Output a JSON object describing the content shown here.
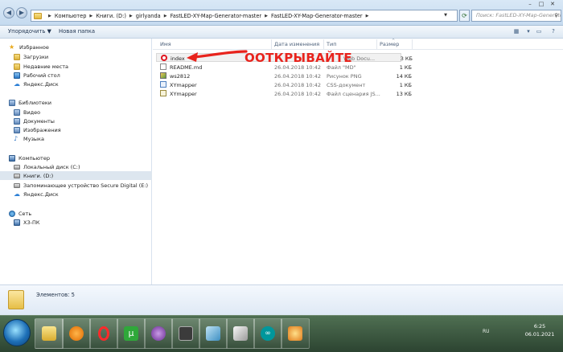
{
  "address": {
    "crumbs": [
      "Компьютер",
      "Книги. (D:)",
      "girlyanda",
      "FastLED-XY-Map-Generator-master",
      "FastLED-XY-Map-Generator-master"
    ]
  },
  "search": {
    "placeholder": "Поиск: FastLED-XY-Map-Generator-..."
  },
  "toolbar": {
    "organize": "Упорядочить ▼",
    "new_folder": "Новая папка"
  },
  "nav": {
    "favorites": "Избранное",
    "downloads": "Загрузки",
    "recent": "Недавние места",
    "desktop": "Рабочий стол",
    "yadisk1": "Яндекс.Диск",
    "libraries": "Библиотеки",
    "video": "Видео",
    "documents": "Документы",
    "images": "Изображения",
    "music": "Музыка",
    "computer": "Компьютер",
    "drive_c": "Локальный диск (C:)",
    "drive_d": "Книги. (D:)",
    "drive_e": "Запоминающее устройство Secure Digital (E:)",
    "yadisk2": "Яндекс.Диск",
    "network": "Сеть",
    "pc": "ХЗ-ПК"
  },
  "columns": {
    "name": "Имя",
    "date": "Дата изменения",
    "type": "Тип",
    "size": "Размер"
  },
  "files": [
    {
      "name": "index",
      "date": "",
      "type": "Web Docu...",
      "size": "3 КБ",
      "icon": "opera-icon"
    },
    {
      "name": "README.md",
      "date": "26.04.2018 10:42",
      "type": "Файл \"MD\"",
      "size": "1 КБ",
      "icon": "document-icon"
    },
    {
      "name": "ws2812",
      "date": "26.04.2018 10:42",
      "type": "Рисунок PNG",
      "size": "14 КБ",
      "icon": "image-icon"
    },
    {
      "name": "XYmapper",
      "date": "26.04.2018 10:42",
      "type": "CSS-документ",
      "size": "1 КБ",
      "icon": "css-icon"
    },
    {
      "name": "XYmapper",
      "date": "26.04.2018 10:42",
      "type": "Файл сценария JS...",
      "size": "13 КБ",
      "icon": "js-icon"
    }
  ],
  "annotation": "ООТКРЫВАЙТЕ",
  "status": {
    "count": "Элементов: 5"
  },
  "tray": {
    "lang": "RU"
  },
  "clock": {
    "time": "6:25",
    "date": "06.01.2021"
  },
  "colors": {
    "annotation": "#e8231c",
    "selection": "#dde6ef"
  }
}
